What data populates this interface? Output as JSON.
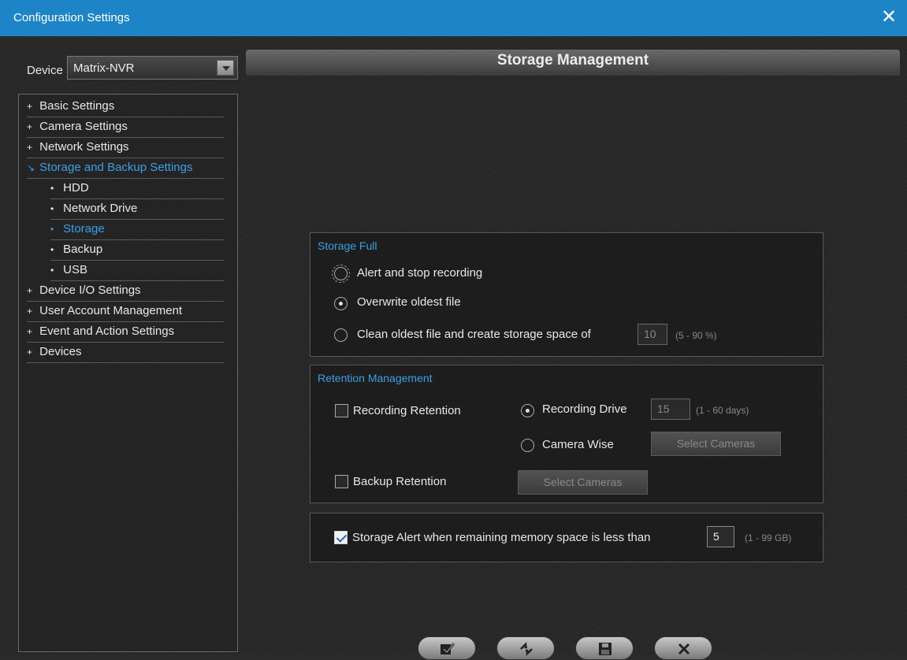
{
  "window": {
    "title": "Configuration Settings"
  },
  "device": {
    "label": "Device",
    "selected": "Matrix-NVR"
  },
  "tree": {
    "items": [
      {
        "prefix": "+",
        "label": "Basic Settings"
      },
      {
        "prefix": "+",
        "label": "Camera Settings"
      },
      {
        "prefix": "+",
        "label": "Network Settings"
      },
      {
        "prefix": "↘",
        "label": "Storage and Backup Settings"
      },
      {
        "prefix": "•",
        "label": "HDD"
      },
      {
        "prefix": "•",
        "label": "Network Drive"
      },
      {
        "prefix": "•",
        "label": "Storage"
      },
      {
        "prefix": "•",
        "label": "Backup"
      },
      {
        "prefix": "•",
        "label": "USB"
      },
      {
        "prefix": "+",
        "label": "Device I/O Settings"
      },
      {
        "prefix": "+",
        "label": "User Account Management"
      },
      {
        "prefix": "+",
        "label": "Event and Action Settings"
      },
      {
        "prefix": "+",
        "label": "Devices"
      }
    ]
  },
  "page": {
    "title": "Storage Management"
  },
  "storage_full": {
    "title": "Storage Full",
    "opt_alert": "Alert and stop recording",
    "opt_overwrite": "Overwrite oldest file",
    "opt_clean": "Clean oldest file and create storage space of",
    "clean_value": "10",
    "clean_range": "(5 - 90 %)"
  },
  "retention": {
    "title": "Retention Management",
    "recording_retention": "Recording Retention",
    "recording_drive": "Recording Drive",
    "drive_value": "15",
    "drive_range": "(1 - 60 days)",
    "camera_wise": "Camera Wise",
    "select_cameras_1": "Select Cameras",
    "backup_retention": "Backup Retention",
    "select_cameras_2": "Select Cameras"
  },
  "alert": {
    "label": "Storage Alert when remaining memory space is less than",
    "value": "5",
    "range": "(1 - 99 GB)"
  },
  "colors": {
    "titlebar": "#1d84c8",
    "accent": "#3aa0e4"
  },
  "icons": {
    "close": "close-icon",
    "apply": "apply-icon",
    "refresh": "refresh-icon",
    "save": "save-icon",
    "cancel": "cancel-icon"
  }
}
